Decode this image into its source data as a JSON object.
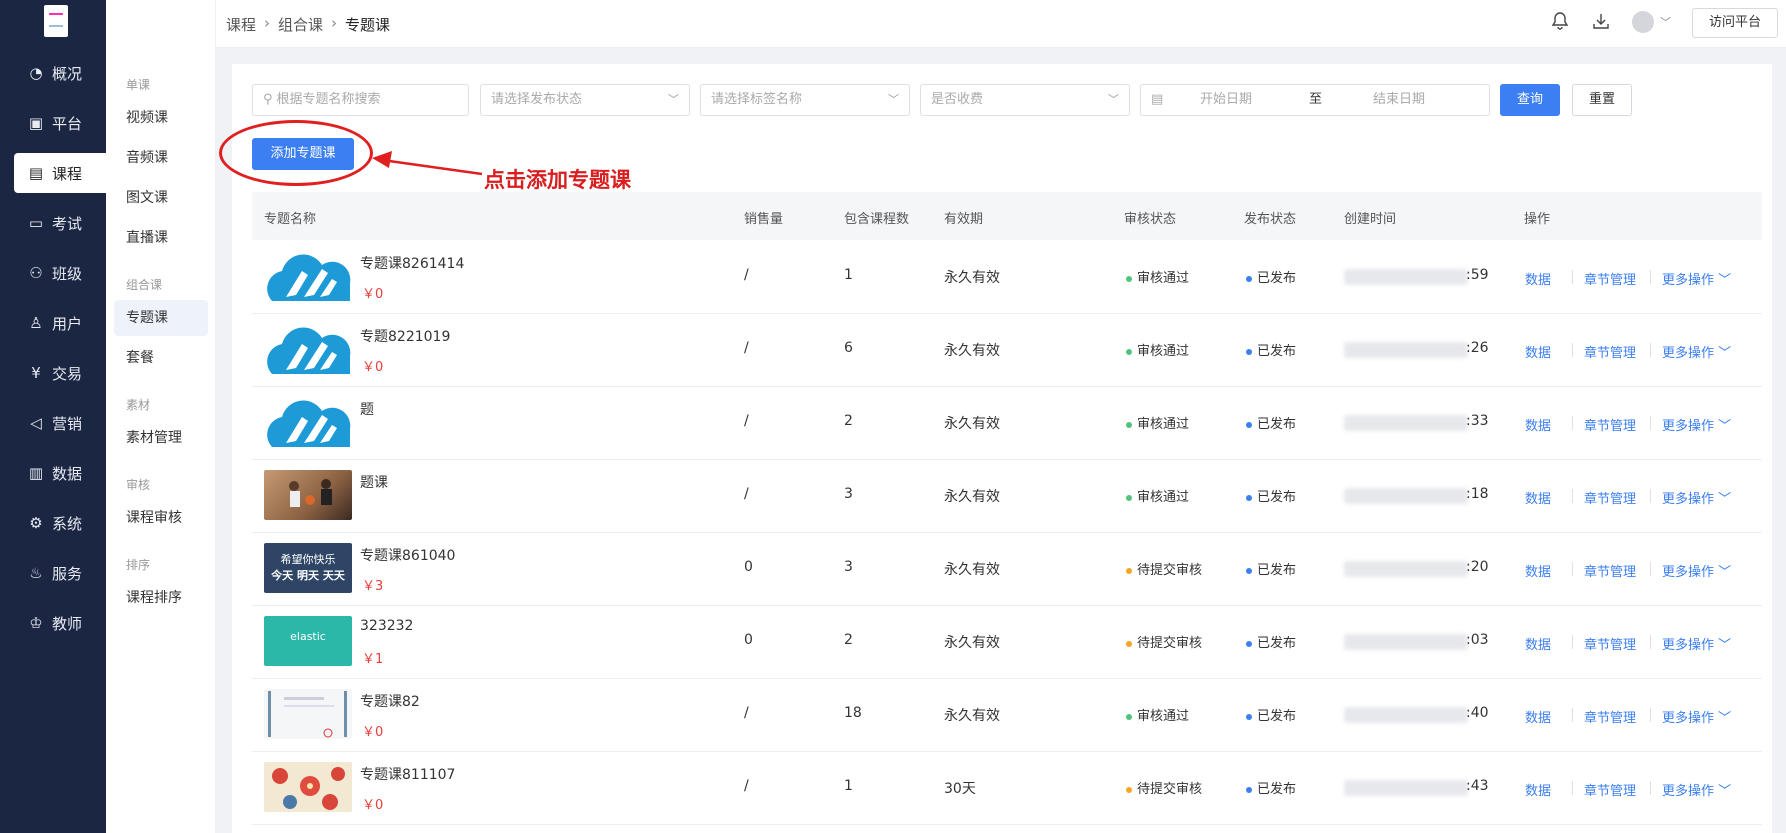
{
  "rail": {
    "items": [
      {
        "label": "概况",
        "icon": "pie-chart-icon"
      },
      {
        "label": "平台",
        "icon": "chart-window-icon"
      },
      {
        "label": "课程",
        "icon": "book-icon"
      },
      {
        "label": "考试",
        "icon": "exam-100-icon"
      },
      {
        "label": "班级",
        "icon": "group-icon"
      },
      {
        "label": "用户",
        "icon": "user-icon"
      },
      {
        "label": "交易",
        "icon": "yen-circle-icon"
      },
      {
        "label": "营销",
        "icon": "megaphone-icon"
      },
      {
        "label": "数据",
        "icon": "bar-chart-icon"
      },
      {
        "label": "系统",
        "icon": "gear-icon"
      },
      {
        "label": "服务",
        "icon": "service-icon"
      },
      {
        "label": "教师",
        "icon": "teacher-icon"
      }
    ],
    "active_index": 2
  },
  "subnav": {
    "groups": [
      {
        "title": "单课",
        "items": [
          "视频课",
          "音频课",
          "图文课",
          "直播课"
        ]
      },
      {
        "title": "组合课",
        "items": [
          "专题课",
          "套餐"
        ]
      },
      {
        "title": "素材",
        "items": [
          "素材管理"
        ]
      },
      {
        "title": "审核",
        "items": [
          "课程审核"
        ]
      },
      {
        "title": "排序",
        "items": [
          "课程排序"
        ]
      }
    ],
    "active": "专题课"
  },
  "breadcrumb": [
    "课程",
    "组合课",
    "专题课"
  ],
  "topbar": {
    "visit_label": "访问平台"
  },
  "filters": {
    "search_placeholder": "根据专题名称搜索",
    "publish_status_placeholder": "请选择发布状态",
    "tag_placeholder": "请选择标签名称",
    "charge_placeholder": "是否收费",
    "start_date_placeholder": "开始日期",
    "date_separator": "至",
    "end_date_placeholder": "结束日期",
    "query_label": "查询",
    "reset_label": "重置"
  },
  "add_button_label": "添加专题课",
  "annotation": "点击添加专题课",
  "table": {
    "headers": [
      "专题名称",
      "销售量",
      "包含课程数",
      "有效期",
      "审核状态",
      "发布状态",
      "创建时间",
      "操作"
    ],
    "rows": [
      {
        "name": "专题课8261414",
        "price": "￥0",
        "sales": "/",
        "count": "1",
        "validity": "永久有效",
        "review": "审核通过",
        "publish": "已发布",
        "time_tail": ":59",
        "thumb": "cloud"
      },
      {
        "name": "专题8221019",
        "price": "￥0",
        "sales": "/",
        "count": "6",
        "validity": "永久有效",
        "review": "审核通过",
        "publish": "已发布",
        "time_tail": ":26",
        "thumb": "cloud"
      },
      {
        "name": "题",
        "price": "",
        "sales": "/",
        "count": "2",
        "validity": "永久有效",
        "review": "审核通过",
        "publish": "已发布",
        "time_tail": ":33",
        "thumb": "cloud"
      },
      {
        "name": "题课",
        "price": "",
        "sales": "/",
        "count": "3",
        "validity": "永久有效",
        "review": "审核通过",
        "publish": "已发布",
        "time_tail": ":18",
        "thumb": "basketball"
      },
      {
        "name": "专题课861040",
        "price": "￥3",
        "sales": "0",
        "count": "3",
        "validity": "永久有效",
        "review": "待提交审核",
        "publish": "已发布",
        "time_tail": ":20",
        "thumb": "banner"
      },
      {
        "name": "323232",
        "price": "￥1",
        "sales": "0",
        "count": "2",
        "validity": "永久有效",
        "review": "待提交审核",
        "publish": "已发布",
        "time_tail": ":03",
        "thumb": "elastic"
      },
      {
        "name": "专题课82",
        "price": "￥0",
        "sales": "/",
        "count": "18",
        "validity": "永久有效",
        "review": "审核通过",
        "publish": "已发布",
        "time_tail": ":40",
        "thumb": "doc"
      },
      {
        "name": "专题课811107",
        "price": "￥0",
        "sales": "/",
        "count": "1",
        "validity": "30天",
        "review": "待提交审核",
        "publish": "已发布",
        "time_tail": ":43",
        "thumb": "flowers"
      }
    ],
    "ops": [
      "数据",
      "章节管理",
      "更多操作"
    ]
  },
  "thumb_texts": {
    "banner_line1": "希望你快乐",
    "banner_line2": "今天 明天 天天",
    "elastic": "elastic"
  },
  "colors": {
    "primary": "#3b7ff3",
    "price": "#e8403a",
    "approved": "#52c47a",
    "pending": "#f5a623",
    "published": "#3b7ff3",
    "annotation": "#d81e1e"
  }
}
